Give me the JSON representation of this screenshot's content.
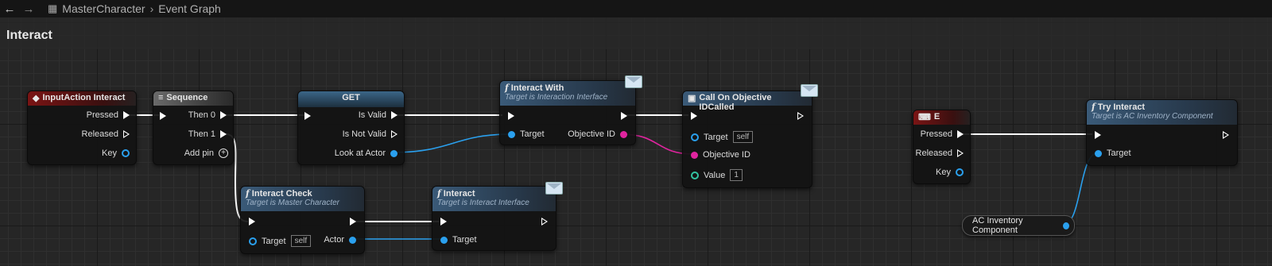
{
  "topbar": {
    "back_icon": "back-arrow-icon",
    "forward_icon": "forward-arrow-icon",
    "breadcrumb_icon": "blueprint-graph-icon",
    "breadcrumb": [
      "MasterCharacter",
      "Event Graph"
    ]
  },
  "graph": {
    "title": "Interact"
  },
  "nodes": {
    "input_action": {
      "title": "InputAction Interact",
      "pins": {
        "pressed": "Pressed",
        "released": "Released",
        "key": "Key"
      }
    },
    "sequence": {
      "title": "Sequence",
      "pins": {
        "then0": "Then 0",
        "then1": "Then 1",
        "add_pin": "Add pin"
      }
    },
    "get": {
      "title": "GET",
      "pins": {
        "is_valid": "Is Valid",
        "is_not_valid": "Is Not Valid",
        "look_at_actor": "Look at Actor"
      }
    },
    "interact_with": {
      "title": "Interact With",
      "subtitle": "Target is Interaction Interface",
      "pins": {
        "target": "Target",
        "objective_id": "Objective ID"
      }
    },
    "call_on_objective": {
      "title": "Call On Objective IDCalled",
      "pins": {
        "target": "Target",
        "target_default": "self",
        "objective_id": "Objective ID",
        "value": "Value",
        "value_default": "1"
      }
    },
    "interact_check": {
      "title": "Interact Check",
      "subtitle": "Target is Master Character",
      "pins": {
        "target": "Target",
        "target_default": "self",
        "actor": "Actor"
      }
    },
    "interact": {
      "title": "Interact",
      "subtitle": "Target is Interact Interface",
      "pins": {
        "target": "Target"
      }
    },
    "key_e": {
      "title": "E",
      "pins": {
        "pressed": "Pressed",
        "released": "Released",
        "key": "Key"
      }
    },
    "try_interact": {
      "title": "Try Interact",
      "subtitle": "Target is AC Inventory Component",
      "pins": {
        "target": "Target"
      }
    },
    "ac_inventory": {
      "label": "AC Inventory Component"
    }
  },
  "colors": {
    "exec": "#ffffff",
    "object": "#2aa0ee",
    "name": "#e0249f",
    "int": "#33c4a2",
    "event_header": "#7a1414",
    "function_header": "#3a5a78"
  }
}
